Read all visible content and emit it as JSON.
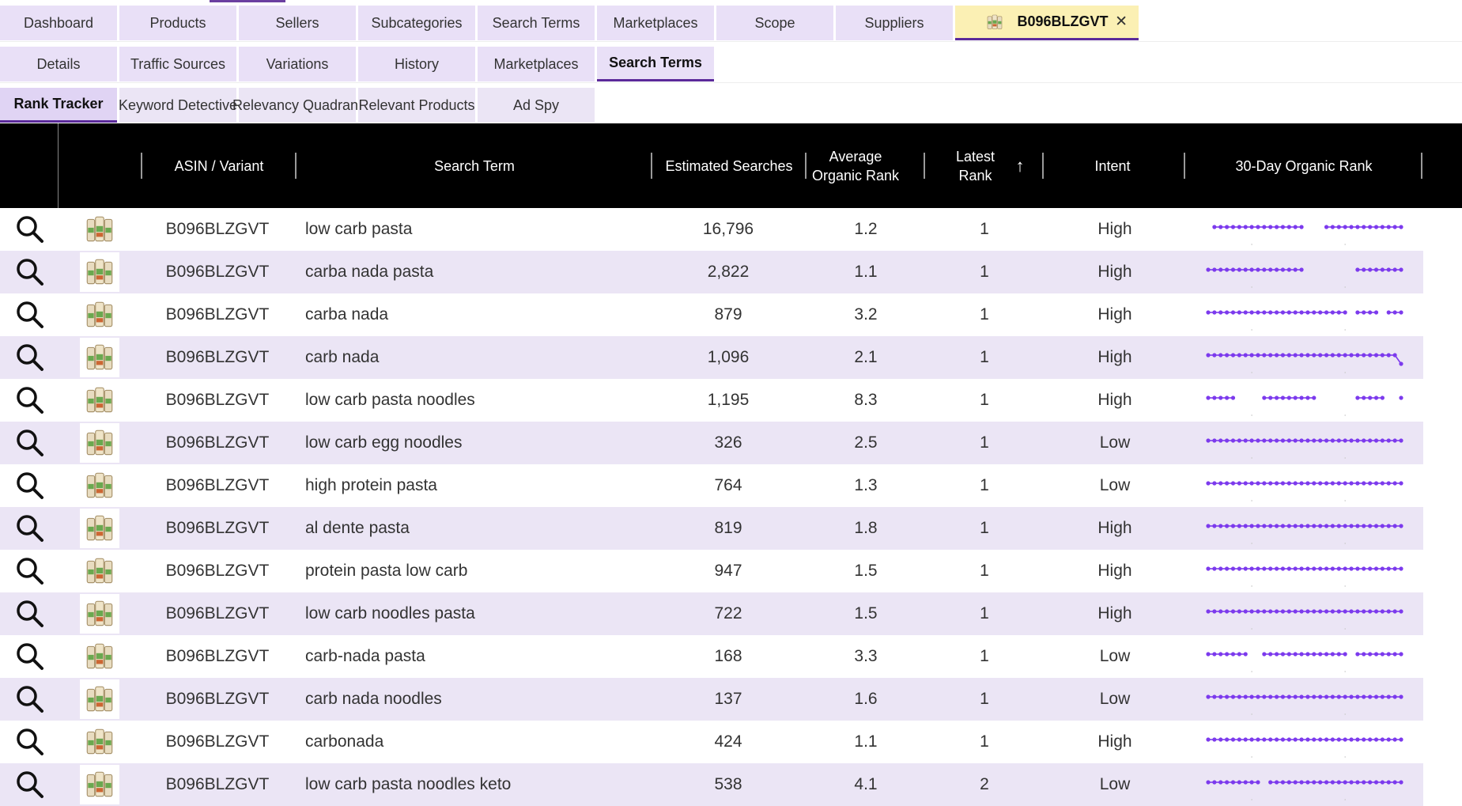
{
  "colors": {
    "accent": "#5b2a9a",
    "tab_bg": "#e9e0f7",
    "product_tab_bg": "#fbf0b4",
    "header_bg": "#000000",
    "row_alt": "#ebe5f5",
    "spark": "#7c3aed"
  },
  "main_tabs": [
    "Dashboard",
    "Products",
    "Sellers",
    "Subcategories",
    "Search Terms",
    "Marketplaces",
    "Scope",
    "Suppliers"
  ],
  "product_tab": {
    "label": "B096BLZGVT",
    "close": "✕"
  },
  "detail_tabs": [
    "Details",
    "Traffic Sources",
    "Variations",
    "History",
    "Marketplaces",
    "Search Terms"
  ],
  "tool_tabs": [
    "Rank Tracker",
    "Keyword Detective",
    "Relevancy Quadrant",
    "Relevant Products",
    "Ad Spy"
  ],
  "columns": {
    "asin": "ASIN / Variant",
    "term": "Search Term",
    "est": "Estimated Searches",
    "avg": "Average Organic Rank",
    "latest": "Latest Rank",
    "sort": "↑",
    "intent": "Intent",
    "rank": "30-Day Organic Rank"
  },
  "rows": [
    {
      "asin": "B096BLZGVT",
      "term": "low carb pasta",
      "est": "16,796",
      "avg": "1.2",
      "latest": "1",
      "intent": "High"
    },
    {
      "asin": "B096BLZGVT",
      "term": "carba nada pasta",
      "est": "2,822",
      "avg": "1.1",
      "latest": "1",
      "intent": "High"
    },
    {
      "asin": "B096BLZGVT",
      "term": "carba nada",
      "est": "879",
      "avg": "3.2",
      "latest": "1",
      "intent": "High"
    },
    {
      "asin": "B096BLZGVT",
      "term": "carb nada",
      "est": "1,096",
      "avg": "2.1",
      "latest": "1",
      "intent": "High"
    },
    {
      "asin": "B096BLZGVT",
      "term": "low carb pasta noodles",
      "est": "1,195",
      "avg": "8.3",
      "latest": "1",
      "intent": "High"
    },
    {
      "asin": "B096BLZGVT",
      "term": "low carb egg noodles",
      "est": "326",
      "avg": "2.5",
      "latest": "1",
      "intent": "Low"
    },
    {
      "asin": "B096BLZGVT",
      "term": "high protein pasta",
      "est": "764",
      "avg": "1.3",
      "latest": "1",
      "intent": "Low"
    },
    {
      "asin": "B096BLZGVT",
      "term": "al dente pasta",
      "est": "819",
      "avg": "1.8",
      "latest": "1",
      "intent": "High"
    },
    {
      "asin": "B096BLZGVT",
      "term": "protein pasta low carb",
      "est": "947",
      "avg": "1.5",
      "latest": "1",
      "intent": "High"
    },
    {
      "asin": "B096BLZGVT",
      "term": "low carb noodles pasta",
      "est": "722",
      "avg": "1.5",
      "latest": "1",
      "intent": "High"
    },
    {
      "asin": "B096BLZGVT",
      "term": "carb-nada pasta",
      "est": "168",
      "avg": "3.3",
      "latest": "1",
      "intent": "Low"
    },
    {
      "asin": "B096BLZGVT",
      "term": "carb nada noodles",
      "est": "137",
      "avg": "1.6",
      "latest": "1",
      "intent": "Low"
    },
    {
      "asin": "B096BLZGVT",
      "term": "carbonada",
      "est": "424",
      "avg": "1.1",
      "latest": "1",
      "intent": "High"
    },
    {
      "asin": "B096BLZGVT",
      "term": "low carb pasta noodles keto",
      "est": "538",
      "avg": "4.1",
      "latest": "2",
      "intent": "Low"
    }
  ]
}
